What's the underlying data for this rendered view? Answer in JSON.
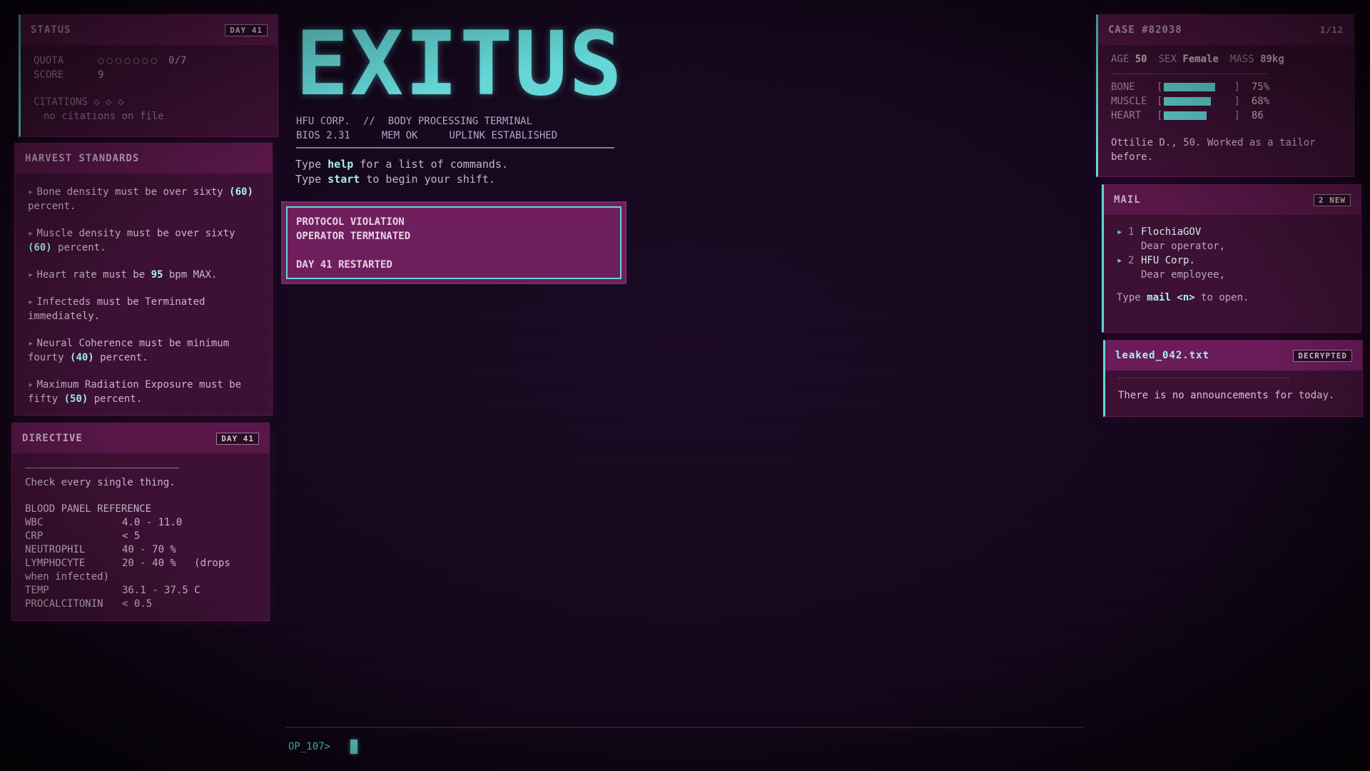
{
  "status": {
    "title": "STATUS",
    "day_badge": "DAY 41",
    "quota_label": "QUOTA",
    "quota_dots": "○○○○○○○",
    "quota_value": "0/7",
    "score_label": "SCORE",
    "score_value": "9",
    "citations_label": "CITATIONS",
    "citations_marks": "◇ ◇ ◇",
    "citations_note": "no citations on file"
  },
  "harvest": {
    "title": "HARVEST STANDARDS",
    "rules": [
      {
        "pre": "Bone density must be over sixty ",
        "hl": "(60)",
        "post": " percent."
      },
      {
        "pre": "Muscle density must be over sixty ",
        "hl": "(60)",
        "post": " percent."
      },
      {
        "pre": "Heart rate must be ",
        "hl": "95",
        "post": " bpm MAX."
      },
      {
        "pre": "Infecteds must be Terminated immediately.",
        "hl": "",
        "post": ""
      },
      {
        "pre": "Neural Coherence must be minimum fourty ",
        "hl": "(40)",
        "post": " percent."
      },
      {
        "pre": "Maximum Radiation Exposure must be fifty ",
        "hl": "(50)",
        "post": " percent."
      }
    ],
    "bullet": "▸"
  },
  "directive": {
    "title": "DIRECTIVE",
    "day_badge": "DAY 41",
    "message": "Check every single thing.",
    "blood_title": "BLOOD PANEL REFERENCE",
    "blood": [
      {
        "name": "WBC",
        "value": "4.0 - 11.0"
      },
      {
        "name": "CRP",
        "value": "< 5"
      },
      {
        "name": "NEUTROPHIL",
        "value": "40 - 70 %"
      },
      {
        "name": "LYMPHOCYTE",
        "value": "20 - 40 %   (drops"
      },
      {
        "name": "when infected)",
        "value": ""
      },
      {
        "name": "TEMP",
        "value": "36.1 - 37.5 C"
      },
      {
        "name": "PROCALCITONIN",
        "value": "< 0.5"
      }
    ]
  },
  "terminal": {
    "logo": "EXITUS",
    "line1a": "HFU CORP.",
    "line1b": "//",
    "line1c": "BODY PROCESSING TERMINAL",
    "line2a": "BIOS 2.31",
    "line2b": "MEM OK",
    "line2c": "UPLINK ESTABLISHED",
    "hint1_pre": "Type ",
    "hint1_cmd": "help",
    "hint1_post": " for a list of commands.",
    "hint2_pre": "Type ",
    "hint2_cmd": "start",
    "hint2_post": " to begin your shift.",
    "alert_line1": "PROTOCOL VIOLATION",
    "alert_line2": "OPERATOR TERMINATED",
    "alert_line3": "DAY 41 RESTARTED",
    "prompt": "OP_107>"
  },
  "case": {
    "title": "CASE #82038",
    "counter": "1/12",
    "age_label": "AGE",
    "age_value": "50",
    "sex_label": "SEX",
    "sex_value": "Female",
    "mass_label": "MASS",
    "mass_value": "89kg",
    "meters": [
      {
        "label": "BONE",
        "fraction": 0.75,
        "text": "75%"
      },
      {
        "label": "MUSCLE",
        "fraction": 0.68,
        "text": "68%"
      },
      {
        "label": "HEART",
        "fraction": 0.62,
        "text": "86"
      }
    ],
    "description": "Ottilie D., 50. Worked as a tailor before."
  },
  "mail": {
    "title": "MAIL",
    "badge": "2 NEW",
    "items": [
      {
        "num": "1",
        "from": "FlochiaGOV",
        "preview": "Dear operator,"
      },
      {
        "num": "2",
        "from": "HFU Corp.",
        "preview": "Dear employee,"
      }
    ],
    "hint_pre": "Type ",
    "hint_cmd": "mail <n>",
    "hint_post": " to open."
  },
  "leak": {
    "title": "leaked_042.txt",
    "badge": "DECRYPTED",
    "message": "There is no announcements for today."
  },
  "colors": {
    "accent": "#63d6d6",
    "panel": "#3b0f32",
    "panel_header": "#561546",
    "alert": "#6e1d5b",
    "background": "#12051a"
  }
}
